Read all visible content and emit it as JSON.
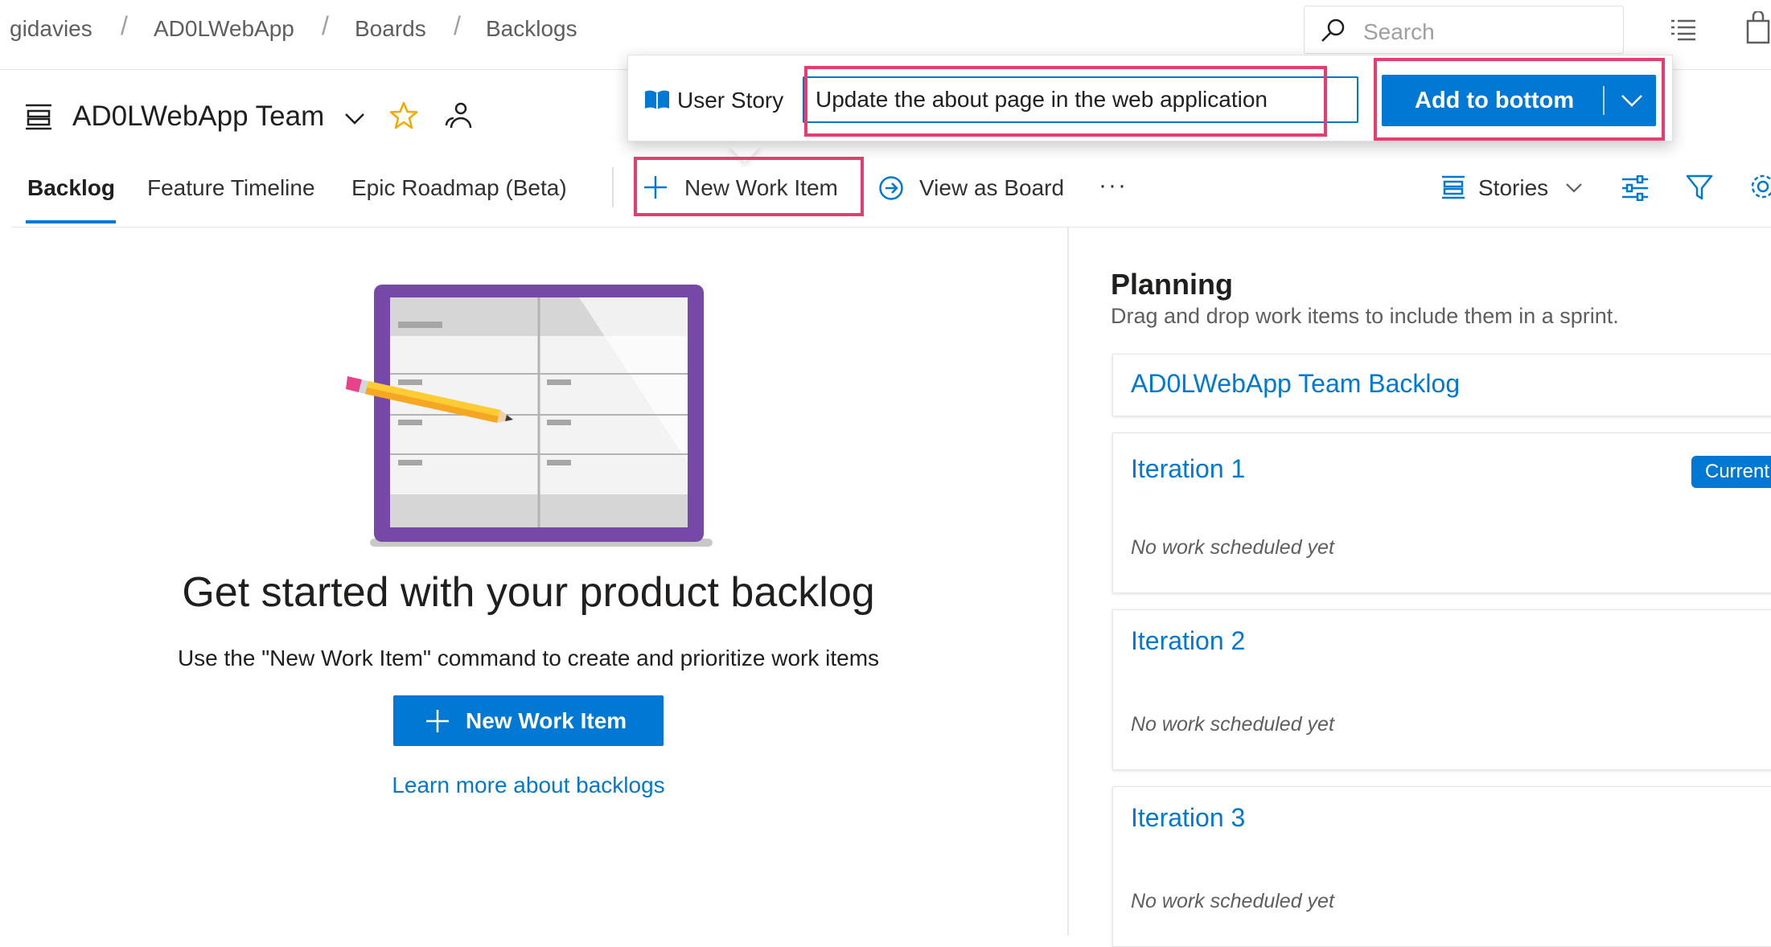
{
  "breadcrumb": [
    "gidavies",
    "AD0LWebApp",
    "Boards",
    "Backlogs"
  ],
  "search": {
    "placeholder": "Search"
  },
  "header": {
    "team_name": "AD0LWebApp Team",
    "tabs": [
      {
        "label": "Backlog",
        "active": true
      },
      {
        "label": "Feature Timeline",
        "active": false
      },
      {
        "label": "Epic Roadmap (Beta)",
        "active": false
      }
    ],
    "toolbar": {
      "new_work_item": "New Work Item",
      "view_as_board": "View as Board",
      "more": "···",
      "level_selector": "Stories"
    }
  },
  "quick_add": {
    "work_item_type": "User Story",
    "title_value": "Update the about page in the web application",
    "add_button": "Add to bottom"
  },
  "empty_state": {
    "heading": "Get started with your product backlog",
    "description": "Use the \"New Work Item\" command to create and prioritize work items",
    "button": "New Work Item",
    "link": "Learn more about backlogs"
  },
  "planning": {
    "title": "Planning",
    "subtitle": "Drag and drop work items to include them in a sprint.",
    "backlog_card": "AD0LWebApp Team Backlog",
    "iterations": [
      {
        "name": "Iteration 1",
        "badge": "Current",
        "status": "No work scheduled yet"
      },
      {
        "name": "Iteration 2",
        "status": "No work scheduled yet"
      },
      {
        "name": "Iteration 3",
        "status": "No work scheduled yet"
      }
    ]
  },
  "colors": {
    "accent": "#0078d4",
    "highlight": "#e43d6f",
    "illustration_frame": "#7649a8",
    "pencil": "#f5a623"
  },
  "icons": [
    "search-icon",
    "list-icon",
    "bag-icon",
    "backlog-icon",
    "chevron-down-icon",
    "star-icon",
    "team-members-icon",
    "plus-icon",
    "arrow-circle-right-icon",
    "stories-icon",
    "settings-sliders-icon",
    "filter-icon",
    "gear-icon",
    "book-icon"
  ]
}
